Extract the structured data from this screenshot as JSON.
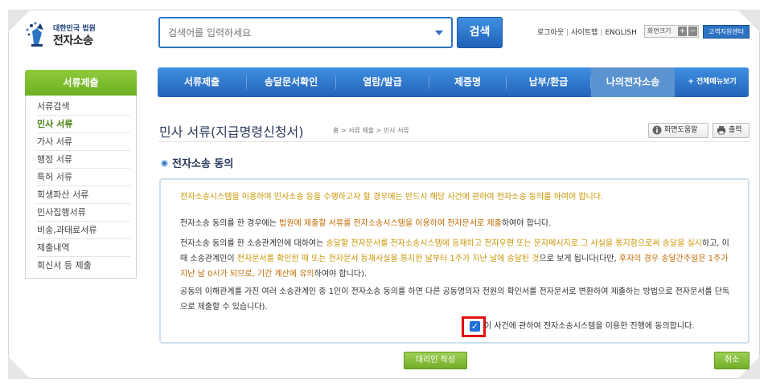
{
  "logo": {
    "subtitle": "대한민국 법원",
    "title": "전자소송"
  },
  "search": {
    "placeholder": "검색어를 입력하세요",
    "button_label": "검색"
  },
  "util_links": [
    "로그아웃",
    "사이트맵",
    "ENGLISH"
  ],
  "font_size_label": "화면크기",
  "font_plus": "+",
  "font_minus": "−",
  "support_label": "고객지원센터",
  "sidebar": {
    "title": "서류제출",
    "items": [
      {
        "label": "서류검색"
      },
      {
        "label": "민사 서류"
      },
      {
        "label": "가사 서류"
      },
      {
        "label": "행정 서류"
      },
      {
        "label": "특허 서류"
      },
      {
        "label": "회생파산 서류"
      },
      {
        "label": "민사집행서류"
      },
      {
        "label": "비송,과태료서류"
      },
      {
        "label": "제출내역"
      },
      {
        "label": "회신서 등 제출"
      }
    ]
  },
  "main_nav": {
    "items": [
      {
        "label": "서류제출"
      },
      {
        "label": "송달문서확인"
      },
      {
        "label": "열람/발급"
      },
      {
        "label": "제증명"
      },
      {
        "label": "납부/환급"
      },
      {
        "label": "나의전자소송"
      }
    ],
    "all_menu": "+ 전체메뉴보기"
  },
  "page": {
    "title": "민사 서류(지급명령신청서)",
    "breadcrumb": "홈 > 서류 제출 > 민사 서류",
    "help_button": "화면도움말",
    "print_button": "출력"
  },
  "section_title": "전자소송 동의",
  "content": {
    "p1": "전자소송시스템을 이용하여 민사소송 등을 수행하고자 할 경우에는 반드시 해당 사건에 관하여 전자소송 동의를 하여야 합니다.",
    "p2_a": "전자소송 동의를 한 경우에는 ",
    "p2_b": "법원에 제출할 서류를 전자소송시스템을 이용하여 전자문서로 제출",
    "p2_c": "하여야 합니다.",
    "p3_a": "전자소송 동의를 한 소송관계인에 대하여는 ",
    "p3_b": "송달할 전자문서를 전자소송시스템에 등재하고 전자우편 또는 문자메시지로 그 사실을 통지함으로써 송달을 실시",
    "p3_c": "하고, 이때 소송관계인이 ",
    "p3_d": "전자문서를 확인한 때 또는 전자문서 등재사실을 통지한 날부터 1주가 지난 날에 송달된 것",
    "p3_e": "으로 보게 됩니다(다만, ",
    "p3_f": "후자의 경우 송달간주일은 1주가 지난 날 0시가 되므로, 기간 계산에 유의",
    "p3_g": "하여야 합니다).",
    "p4": "공동의 이해관계를 가진 여러 소송관계인 중 1인이 전자소송 동의를 하면 다른 공동명의자 전원의 확인서를 전자문서로 변환하여 제출하는 방법으로 전자문서를 단독으로 제출할 수 있습니다).",
    "agree_label": "이 사건에 관하여 전자소송시스템을 이용한 진행에 동의합니다."
  },
  "buttons": {
    "agent": "대리인 작성",
    "cancel": "취소"
  }
}
